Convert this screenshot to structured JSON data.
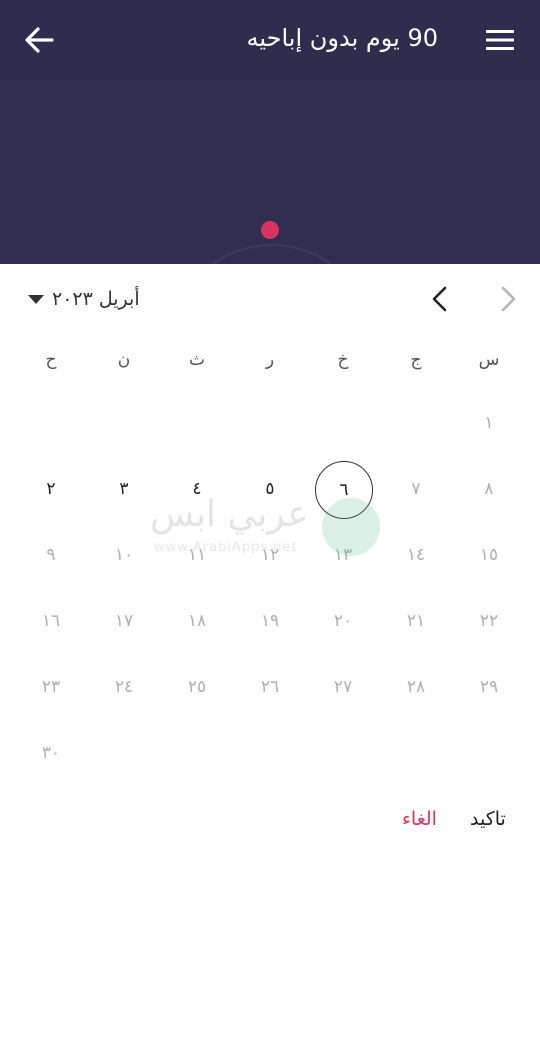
{
  "header": {
    "title": "90 يوم بدون إباحيه",
    "back_icon": "arrow-left-icon",
    "menu_icon": "hamburger-menu-icon",
    "background": "#302c4d"
  },
  "hero": {
    "accent_dot_color": "#d8345f"
  },
  "date_picker": {
    "month_label": "أبريل ٢٠٢٣",
    "dropdown_icon": "triangle-down-icon",
    "prev_icon": "chevron-left-icon",
    "next_icon": "chevron-right-icon",
    "weekdays": [
      "س",
      "ج",
      "خ",
      "ر",
      "ث",
      "ن",
      "ح"
    ],
    "weeks": [
      [
        {
          "label": "١",
          "state": "disabled"
        },
        null,
        null,
        null,
        null,
        null,
        null
      ],
      [
        {
          "label": "٨",
          "state": "disabled"
        },
        {
          "label": "٧",
          "state": "disabled"
        },
        {
          "label": "٦",
          "state": "selected"
        },
        {
          "label": "٥",
          "state": "active"
        },
        {
          "label": "٤",
          "state": "active"
        },
        {
          "label": "٣",
          "state": "active"
        },
        {
          "label": "٢",
          "state": "active"
        }
      ],
      [
        {
          "label": "١٥",
          "state": "disabled"
        },
        {
          "label": "١٤",
          "state": "disabled"
        },
        {
          "label": "١٣",
          "state": "disabled"
        },
        {
          "label": "١٢",
          "state": "disabled"
        },
        {
          "label": "١١",
          "state": "disabled"
        },
        {
          "label": "١٠",
          "state": "disabled"
        },
        {
          "label": "٩",
          "state": "disabled"
        }
      ],
      [
        {
          "label": "٢٢",
          "state": "disabled"
        },
        {
          "label": "٢١",
          "state": "disabled"
        },
        {
          "label": "٢٠",
          "state": "disabled"
        },
        {
          "label": "١٩",
          "state": "disabled"
        },
        {
          "label": "١٨",
          "state": "disabled"
        },
        {
          "label": "١٧",
          "state": "disabled"
        },
        {
          "label": "١٦",
          "state": "disabled"
        }
      ],
      [
        {
          "label": "٢٩",
          "state": "disabled"
        },
        {
          "label": "٢٨",
          "state": "disabled"
        },
        {
          "label": "٢٧",
          "state": "disabled"
        },
        {
          "label": "٢٦",
          "state": "disabled"
        },
        {
          "label": "٢٥",
          "state": "disabled"
        },
        {
          "label": "٢٤",
          "state": "disabled"
        },
        {
          "label": "٢٣",
          "state": "disabled"
        }
      ],
      [
        null,
        null,
        null,
        null,
        null,
        null,
        {
          "label": "٣٠",
          "state": "disabled"
        }
      ]
    ],
    "confirm_label": "تاكيد",
    "cancel_label": "الغاء",
    "cancel_color": "#d8345f"
  },
  "watermark": {
    "text": "عربي ابس",
    "subtext": "www.ArabiApps.net"
  }
}
